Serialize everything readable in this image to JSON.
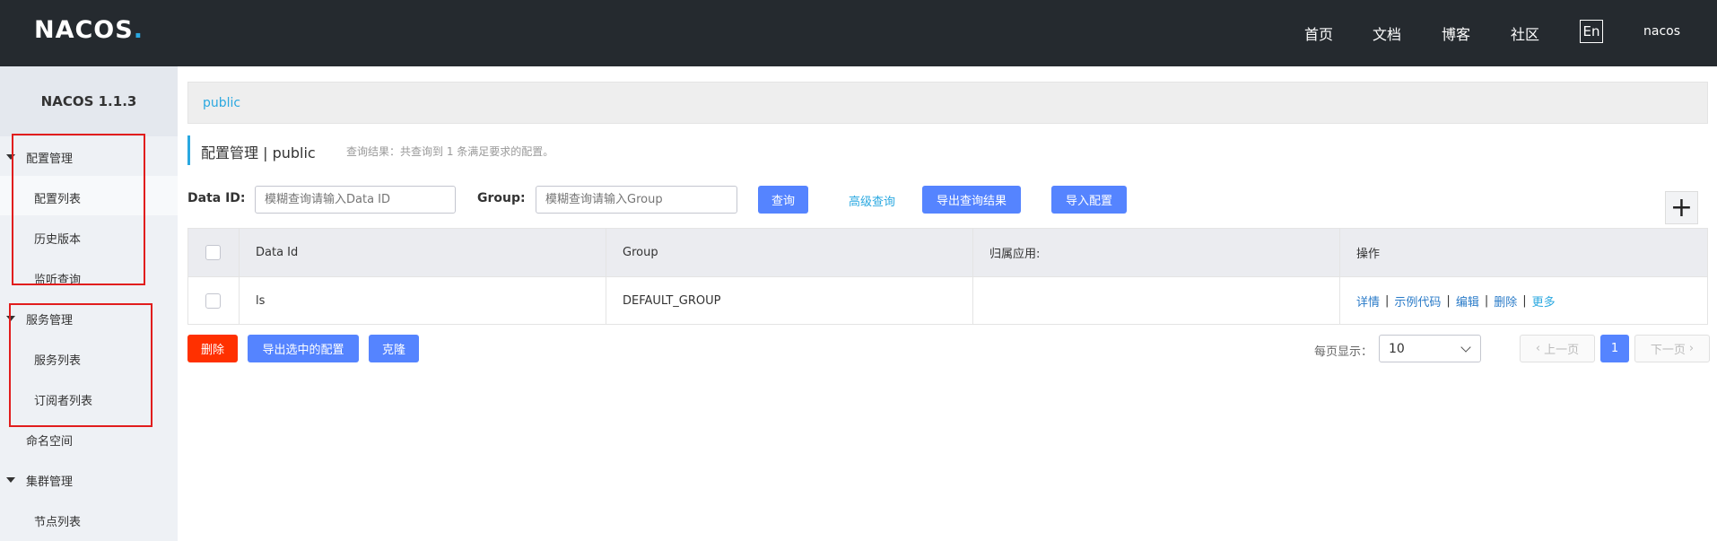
{
  "header": {
    "logo": "NACOS",
    "logo_dot": ".",
    "nav": [
      "首页",
      "文档",
      "博客",
      "社区"
    ],
    "lang": "En",
    "user": "nacos"
  },
  "sidebar": {
    "title": "NACOS 1.1.3",
    "groups": [
      {
        "label": "配置管理",
        "items": [
          "配置列表",
          "历史版本",
          "监听查询"
        ]
      },
      {
        "label": "服务管理",
        "items": [
          "服务列表",
          "订阅者列表"
        ]
      },
      {
        "label": "命名空间",
        "items": []
      },
      {
        "label": "集群管理",
        "items": [
          "节点列表"
        ]
      }
    ]
  },
  "breadcrumb": "public",
  "page": {
    "title": "配置管理 | public",
    "result_text": "查询结果：共查询到 1 条满足要求的配置。"
  },
  "search": {
    "dataid_label": "Data ID:",
    "dataid_placeholder": "模糊查询请输入Data ID",
    "group_label": "Group:",
    "group_placeholder": "模糊查询请输入Group",
    "query_button": "查询",
    "advanced_query": "高级查询",
    "export_button": "导出查询结果",
    "import_button": "导入配置"
  },
  "table": {
    "headers": [
      "Data Id",
      "Group",
      "归属应用:",
      "操作"
    ],
    "rows": [
      {
        "data_id": "ls",
        "group": "DEFAULT_GROUP",
        "app": "",
        "ops": [
          "详情",
          "示例代码",
          "编辑",
          "删除",
          "更多"
        ]
      }
    ]
  },
  "bulk": {
    "delete": "删除",
    "export_selected": "导出选中的配置",
    "clone": "克隆"
  },
  "pager": {
    "per_page_label": "每页显示：",
    "per_page_value": "10",
    "prev": "上一页",
    "current": "1",
    "next": "下一页"
  }
}
